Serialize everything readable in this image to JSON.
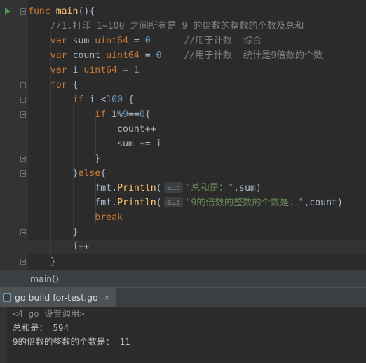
{
  "editor": {
    "lines": [
      {
        "tokens": [
          {
            "t": "func ",
            "c": "kw"
          },
          {
            "t": "main",
            "c": "fn"
          },
          {
            "t": "(){",
            "c": ""
          }
        ]
      },
      {
        "tokens": [
          {
            "t": "    //1.打印 1~100 之间所有是 9 的倍数的整数的个数及总和",
            "c": "cm"
          }
        ]
      },
      {
        "tokens": [
          {
            "t": "    ",
            "c": ""
          },
          {
            "t": "var ",
            "c": "kw"
          },
          {
            "t": "sum ",
            "c": ""
          },
          {
            "t": "uint64",
            "c": "kw"
          },
          {
            "t": " = ",
            "c": ""
          },
          {
            "t": "0",
            "c": "num"
          },
          {
            "t": "      //用于计数  综合",
            "c": "cm"
          }
        ]
      },
      {
        "tokens": [
          {
            "t": "    ",
            "c": ""
          },
          {
            "t": "var ",
            "c": "kw"
          },
          {
            "t": "count ",
            "c": ""
          },
          {
            "t": "uint64",
            "c": "kw"
          },
          {
            "t": " = ",
            "c": ""
          },
          {
            "t": "0",
            "c": "num"
          },
          {
            "t": "    //用于计数  统计是9倍数的个数",
            "c": "cm"
          }
        ]
      },
      {
        "tokens": [
          {
            "t": "    ",
            "c": ""
          },
          {
            "t": "var ",
            "c": "kw"
          },
          {
            "t": "i ",
            "c": ""
          },
          {
            "t": "uint64",
            "c": "kw"
          },
          {
            "t": " = ",
            "c": ""
          },
          {
            "t": "1",
            "c": "num"
          }
        ]
      },
      {
        "tokens": [
          {
            "t": "    ",
            "c": ""
          },
          {
            "t": "for",
            "c": "kw"
          },
          {
            "t": " {",
            "c": ""
          }
        ]
      },
      {
        "tokens": [
          {
            "t": "        ",
            "c": ""
          },
          {
            "t": "if",
            "c": "kw"
          },
          {
            "t": " i <",
            "c": ""
          },
          {
            "t": "100",
            "c": "num"
          },
          {
            "t": " {",
            "c": ""
          }
        ]
      },
      {
        "tokens": [
          {
            "t": "            ",
            "c": ""
          },
          {
            "t": "if",
            "c": "kw"
          },
          {
            "t": " i%",
            "c": ""
          },
          {
            "t": "9",
            "c": "num"
          },
          {
            "t": "==",
            "c": ""
          },
          {
            "t": "0",
            "c": "num"
          },
          {
            "t": "{",
            "c": ""
          }
        ]
      },
      {
        "tokens": [
          {
            "t": "                count++",
            "c": ""
          }
        ]
      },
      {
        "tokens": [
          {
            "t": "                sum += i",
            "c": ""
          }
        ]
      },
      {
        "tokens": [
          {
            "t": "            }",
            "c": ""
          }
        ]
      },
      {
        "tokens": [
          {
            "t": "        }",
            "c": ""
          },
          {
            "t": "else",
            "c": "kw"
          },
          {
            "t": "{",
            "c": ""
          }
        ]
      },
      {
        "tokens": [
          {
            "t": "            ",
            "c": ""
          },
          {
            "t": "fmt",
            "c": "pkg"
          },
          {
            "t": ".",
            "c": ""
          },
          {
            "t": "Println",
            "c": "mth"
          },
          {
            "t": "(",
            "c": ""
          },
          {
            "t": "a…:",
            "c": "hint"
          },
          {
            "t": "\"总和是：\"",
            "c": "str"
          },
          {
            "t": ",sum)",
            "c": ""
          }
        ]
      },
      {
        "tokens": [
          {
            "t": "            ",
            "c": ""
          },
          {
            "t": "fmt",
            "c": "pkg"
          },
          {
            "t": ".",
            "c": ""
          },
          {
            "t": "Println",
            "c": "mth"
          },
          {
            "t": "(",
            "c": ""
          },
          {
            "t": "a…:",
            "c": "hint"
          },
          {
            "t": "\"9的倍数的整数的个数是：\"",
            "c": "str"
          },
          {
            "t": ",count)",
            "c": ""
          }
        ]
      },
      {
        "tokens": [
          {
            "t": "            ",
            "c": ""
          },
          {
            "t": "break",
            "c": "kw"
          }
        ]
      },
      {
        "tokens": [
          {
            "t": "        }",
            "c": ""
          }
        ]
      },
      {
        "tokens": [
          {
            "t": "        i++",
            "c": ""
          }
        ]
      },
      {
        "tokens": [
          {
            "t": "    }",
            "c": ""
          }
        ]
      }
    ],
    "highlighted_line": 16
  },
  "breadcrumb": {
    "text": "main()"
  },
  "run_tab": {
    "label": "go build for-test.go",
    "close": "×"
  },
  "console": {
    "lines": [
      {
        "text": "<4 go 设置调用>",
        "dim": true
      },
      {
        "text": "总和是： 594",
        "dim": false
      },
      {
        "text": "9的倍数的整数的个数是： 11",
        "dim": false
      }
    ]
  },
  "colors": {
    "background": "#2b2b2b",
    "keyword": "#cc7832",
    "function": "#ffc66d",
    "number": "#6897bb",
    "comment": "#808080",
    "string": "#6a8759"
  }
}
